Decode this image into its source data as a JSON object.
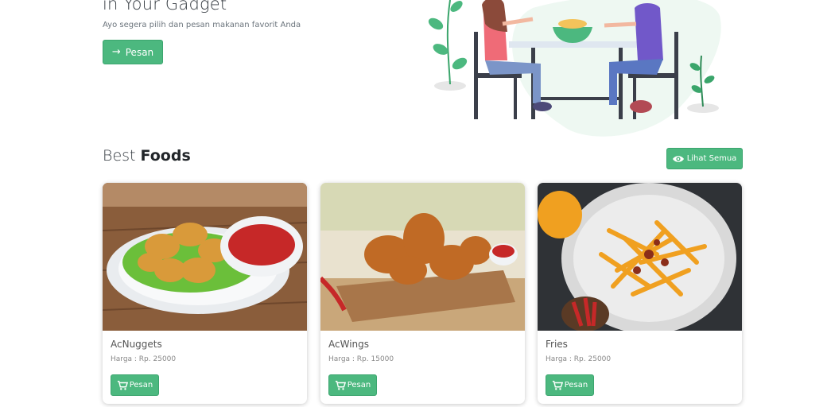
{
  "hero": {
    "title": "in Your Gadget",
    "subtitle": "Ayo segera pilih dan pesan makanan favorit Anda",
    "button_label": "Pesan",
    "button_icon": "arrow-right-icon"
  },
  "section": {
    "title_light": "Best ",
    "title_bold": "Foods",
    "see_all_label": "Lihat Semua",
    "see_all_icon": "eye-icon"
  },
  "foods": [
    {
      "name": "AcNuggets",
      "price": "Harga : Rp. 25000",
      "button_label": "Pesan",
      "button_icon": "cart-icon"
    },
    {
      "name": "AcWings",
      "price": "Harga : Rp. 15000",
      "button_label": "Pesan",
      "button_icon": "cart-icon"
    },
    {
      "name": "Fries",
      "price": "Harga : Rp. 25000",
      "button_label": "Pesan",
      "button_icon": "cart-icon"
    }
  ],
  "colors": {
    "accent": "#4cb87f",
    "text_dark": "#212529",
    "text_muted": "#6c757d"
  }
}
